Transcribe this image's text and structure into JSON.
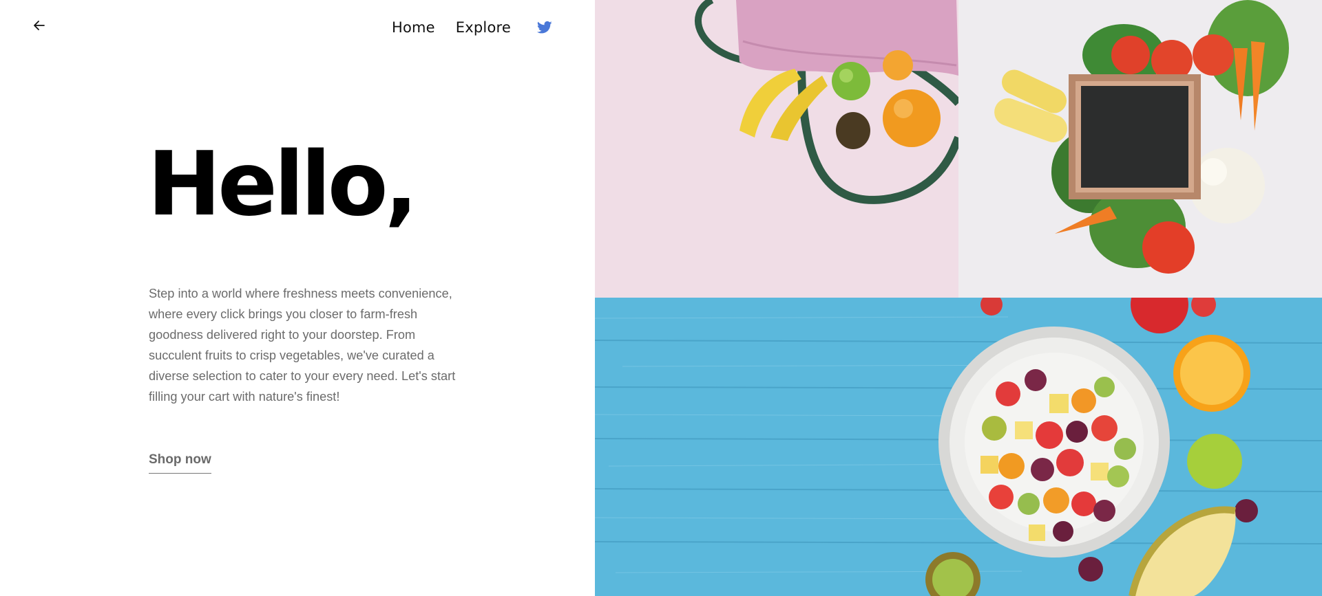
{
  "nav": {
    "back_icon": "arrow-left-icon",
    "home_label": "Home",
    "explore_label": "Explore",
    "social_icon": "twitter-icon",
    "social_color": "#4a78d8"
  },
  "hero": {
    "title": "Hello,",
    "description": "Step into a world where freshness meets convenience, where every click brings you closer to farm-fresh goodness delivered right to your doorstep. From succulent fruits to crisp vegetables, we've curated a diverse selection to cater to your every need. Let's start filling your cart with nature's finest!",
    "cta_label": "Shop now"
  },
  "colors": {
    "title": "#000000",
    "body_text": "#6b6b6b",
    "pink_background": "#f0dde6",
    "light_background": "#eeecef",
    "blue_background": "#5bb8dc"
  }
}
